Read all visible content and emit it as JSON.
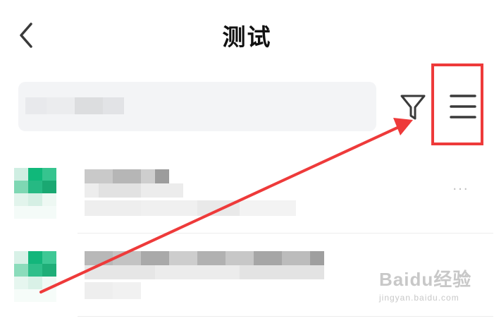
{
  "header": {
    "title": "测试",
    "back_icon": "chevron-left-icon"
  },
  "toolbar": {
    "search_placeholder_obscured": true,
    "filter_icon": "filter-funnel-icon",
    "menu_icon": "hamburger-menu-icon"
  },
  "annotation": {
    "color": "#ee3a3a",
    "type": "arrow-and-box highlighting the menu button"
  },
  "file_list": {
    "items": [
      {
        "name_obscured": true,
        "more_label": "···"
      },
      {
        "name_obscured": true,
        "more_label": "···"
      }
    ]
  },
  "watermark": {
    "main": "Baidu经验",
    "sub": "jingyan.baidu.com"
  },
  "colors": {
    "accent": "#1fbf84",
    "annotation": "#ee3a3a",
    "search_bg": "#f3f4f6",
    "icon": "#3a3a3a"
  }
}
